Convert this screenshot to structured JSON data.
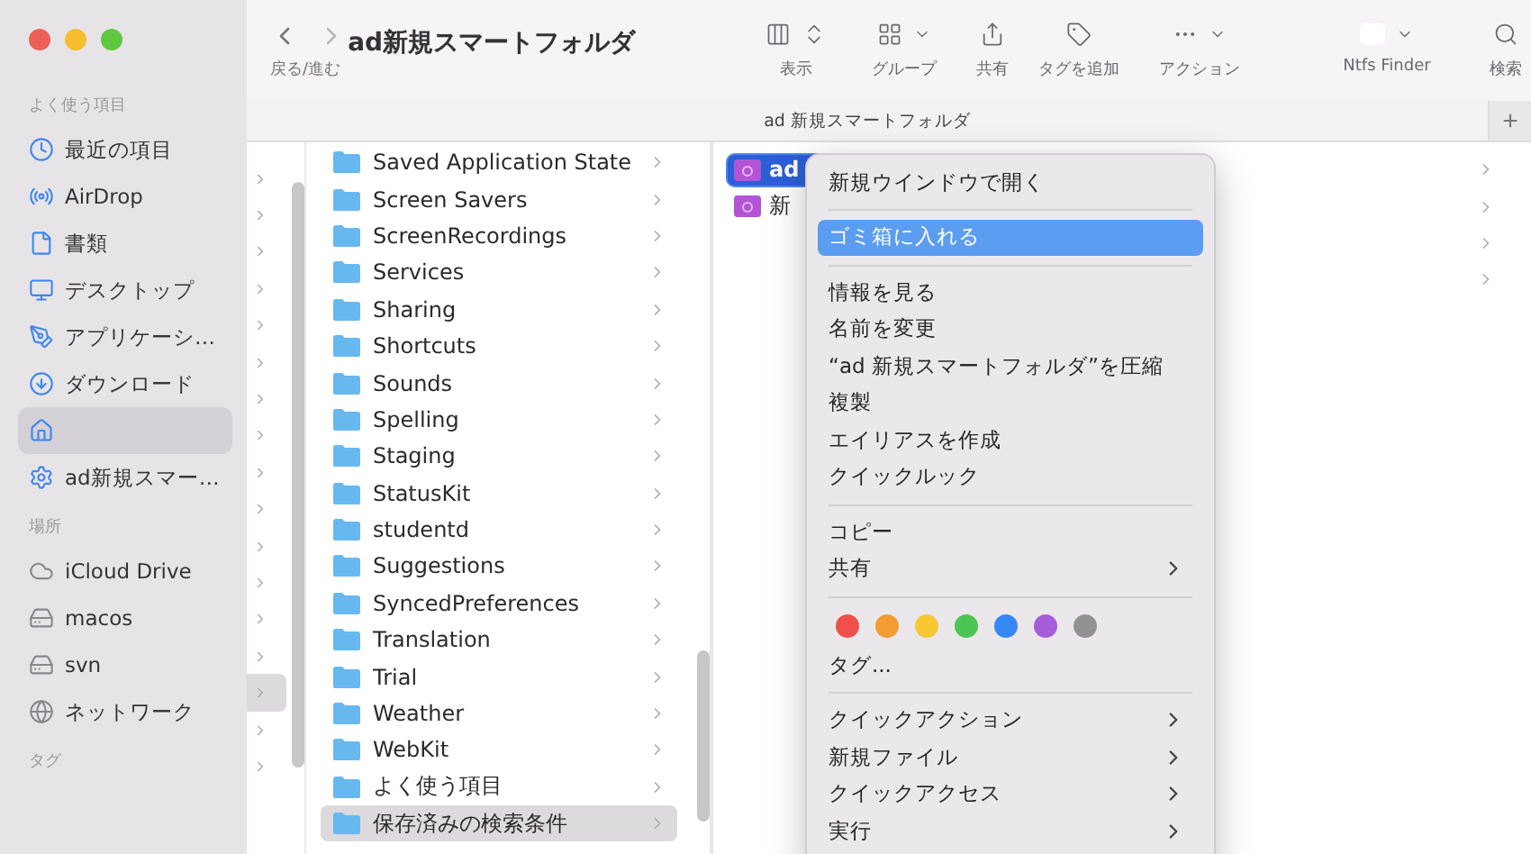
{
  "window": {
    "controls": [
      {
        "color": "#ed5f57"
      },
      {
        "color": "#f5bd2f"
      },
      {
        "color": "#5fc83f"
      }
    ]
  },
  "toolbar": {
    "title": "ad新規スマートフォルダ",
    "nav_label": "戻る/進む",
    "items": [
      {
        "label": "表示"
      },
      {
        "label": "グループ"
      },
      {
        "label": "共有"
      },
      {
        "label": "タグを追加"
      },
      {
        "label": "アクション"
      },
      {
        "label": "Ntfs Finder"
      },
      {
        "label": "検索"
      }
    ]
  },
  "path_bar": {
    "title": "ad 新規スマートフォルダ",
    "add": "+"
  },
  "sidebar": {
    "sections": [
      {
        "title": "よく使う項目",
        "items": [
          {
            "label": "最近の項目",
            "selected": false
          },
          {
            "label": "AirDrop",
            "selected": false
          },
          {
            "label": "書類",
            "selected": false
          },
          {
            "label": "デスクトップ",
            "selected": false
          },
          {
            "label": "アプリケーシ…",
            "selected": false
          },
          {
            "label": "ダウンロード",
            "selected": false
          },
          {
            "selected": true
          },
          {
            "label": "ad新規スマー…",
            "selected": false
          }
        ]
      },
      {
        "title": "場所",
        "items": [
          {
            "label": "iCloud Drive",
            "selected": false
          },
          {
            "label": "macos",
            "selected": false
          },
          {
            "label": "svn",
            "selected": false
          },
          {
            "label": "ネットワーク",
            "selected": false
          }
        ]
      },
      {
        "title": "タグ"
      }
    ]
  },
  "column_1": {
    "rows": [
      {
        "selected": false
      },
      {
        "selected": false
      },
      {
        "selected": false
      },
      {
        "selected": false
      },
      {
        "selected": false
      },
      {
        "selected": false
      },
      {
        "selected": false
      },
      {
        "selected": false
      },
      {
        "selected": false
      },
      {
        "selected": false
      },
      {
        "selected": false
      },
      {
        "selected": false
      },
      {
        "selected": false
      },
      {
        "selected": false
      },
      {
        "selected": true
      },
      {
        "selected": false
      },
      {
        "selected": false
      }
    ]
  },
  "column_2": {
    "rows": [
      {
        "name": "Saved Application State",
        "selected": false
      },
      {
        "name": "Screen Savers",
        "selected": false
      },
      {
        "name": "ScreenRecordings",
        "selected": false
      },
      {
        "name": "Services",
        "selected": false
      },
      {
        "name": "Sharing",
        "selected": false
      },
      {
        "name": "Shortcuts",
        "selected": false
      },
      {
        "name": "Sounds",
        "selected": false
      },
      {
        "name": "Spelling",
        "selected": false
      },
      {
        "name": "Staging",
        "selected": false
      },
      {
        "name": "StatusKit",
        "selected": false
      },
      {
        "name": "studentd",
        "selected": false
      },
      {
        "name": "Suggestions",
        "selected": false
      },
      {
        "name": "SyncedPreferences",
        "selected": false
      },
      {
        "name": "Translation",
        "selected": false
      },
      {
        "name": "Trial",
        "selected": false
      },
      {
        "name": "Weather",
        "selected": false
      },
      {
        "name": "WebKit",
        "selected": false
      },
      {
        "name": "よく使う項目",
        "selected": false
      },
      {
        "name": "保存済みの検索条件",
        "selected": true
      }
    ]
  },
  "column_3": {
    "rows": [
      {
        "name": "ad",
        "selected": true
      },
      {
        "name": "新",
        "selected": false
      },
      {
        "selected": false
      },
      {
        "selected": false
      }
    ]
  },
  "context_menu": {
    "items": [
      {
        "kind": "item",
        "label": "新規ウインドウで開く",
        "selected": false,
        "submenu": false
      },
      {
        "kind": "separator"
      },
      {
        "kind": "item",
        "label": "ゴミ箱に入れる",
        "selected": true,
        "submenu": false
      },
      {
        "kind": "separator"
      },
      {
        "kind": "item",
        "label": "情報を見る",
        "selected": false,
        "submenu": false
      },
      {
        "kind": "item",
        "label": "名前を変更",
        "selected": false,
        "submenu": false
      },
      {
        "kind": "item",
        "label": "“ad 新規スマートフォルダ”を圧縮",
        "selected": false,
        "submenu": false
      },
      {
        "kind": "item",
        "label": "複製",
        "selected": false,
        "submenu": false
      },
      {
        "kind": "item",
        "label": "エイリアスを作成",
        "selected": false,
        "submenu": false
      },
      {
        "kind": "item",
        "label": "クイックルック",
        "selected": false,
        "submenu": false
      },
      {
        "kind": "separator"
      },
      {
        "kind": "item",
        "label": "コピー",
        "selected": false,
        "submenu": false
      },
      {
        "kind": "item",
        "label": "共有",
        "selected": false,
        "submenu": true
      },
      {
        "kind": "separator"
      },
      {
        "kind": "tags",
        "colors": [
          {
            "color": "#f0504a"
          },
          {
            "color": "#f39c32"
          },
          {
            "color": "#f7c833"
          },
          {
            "color": "#4cc552"
          },
          {
            "color": "#3687f5"
          },
          {
            "color": "#a55ed8"
          },
          {
            "color": "#929293"
          }
        ]
      },
      {
        "kind": "item",
        "label": "タグ...",
        "selected": false,
        "submenu": false
      },
      {
        "kind": "separator"
      },
      {
        "kind": "item",
        "label": "クイックアクション",
        "selected": false,
        "submenu": true
      },
      {
        "kind": "item",
        "label": "新規ファイル",
        "selected": false,
        "submenu": true
      },
      {
        "kind": "item",
        "label": "クイックアクセス",
        "selected": false,
        "submenu": true
      },
      {
        "kind": "item",
        "label": "実行",
        "selected": false,
        "submenu": true
      }
    ]
  }
}
